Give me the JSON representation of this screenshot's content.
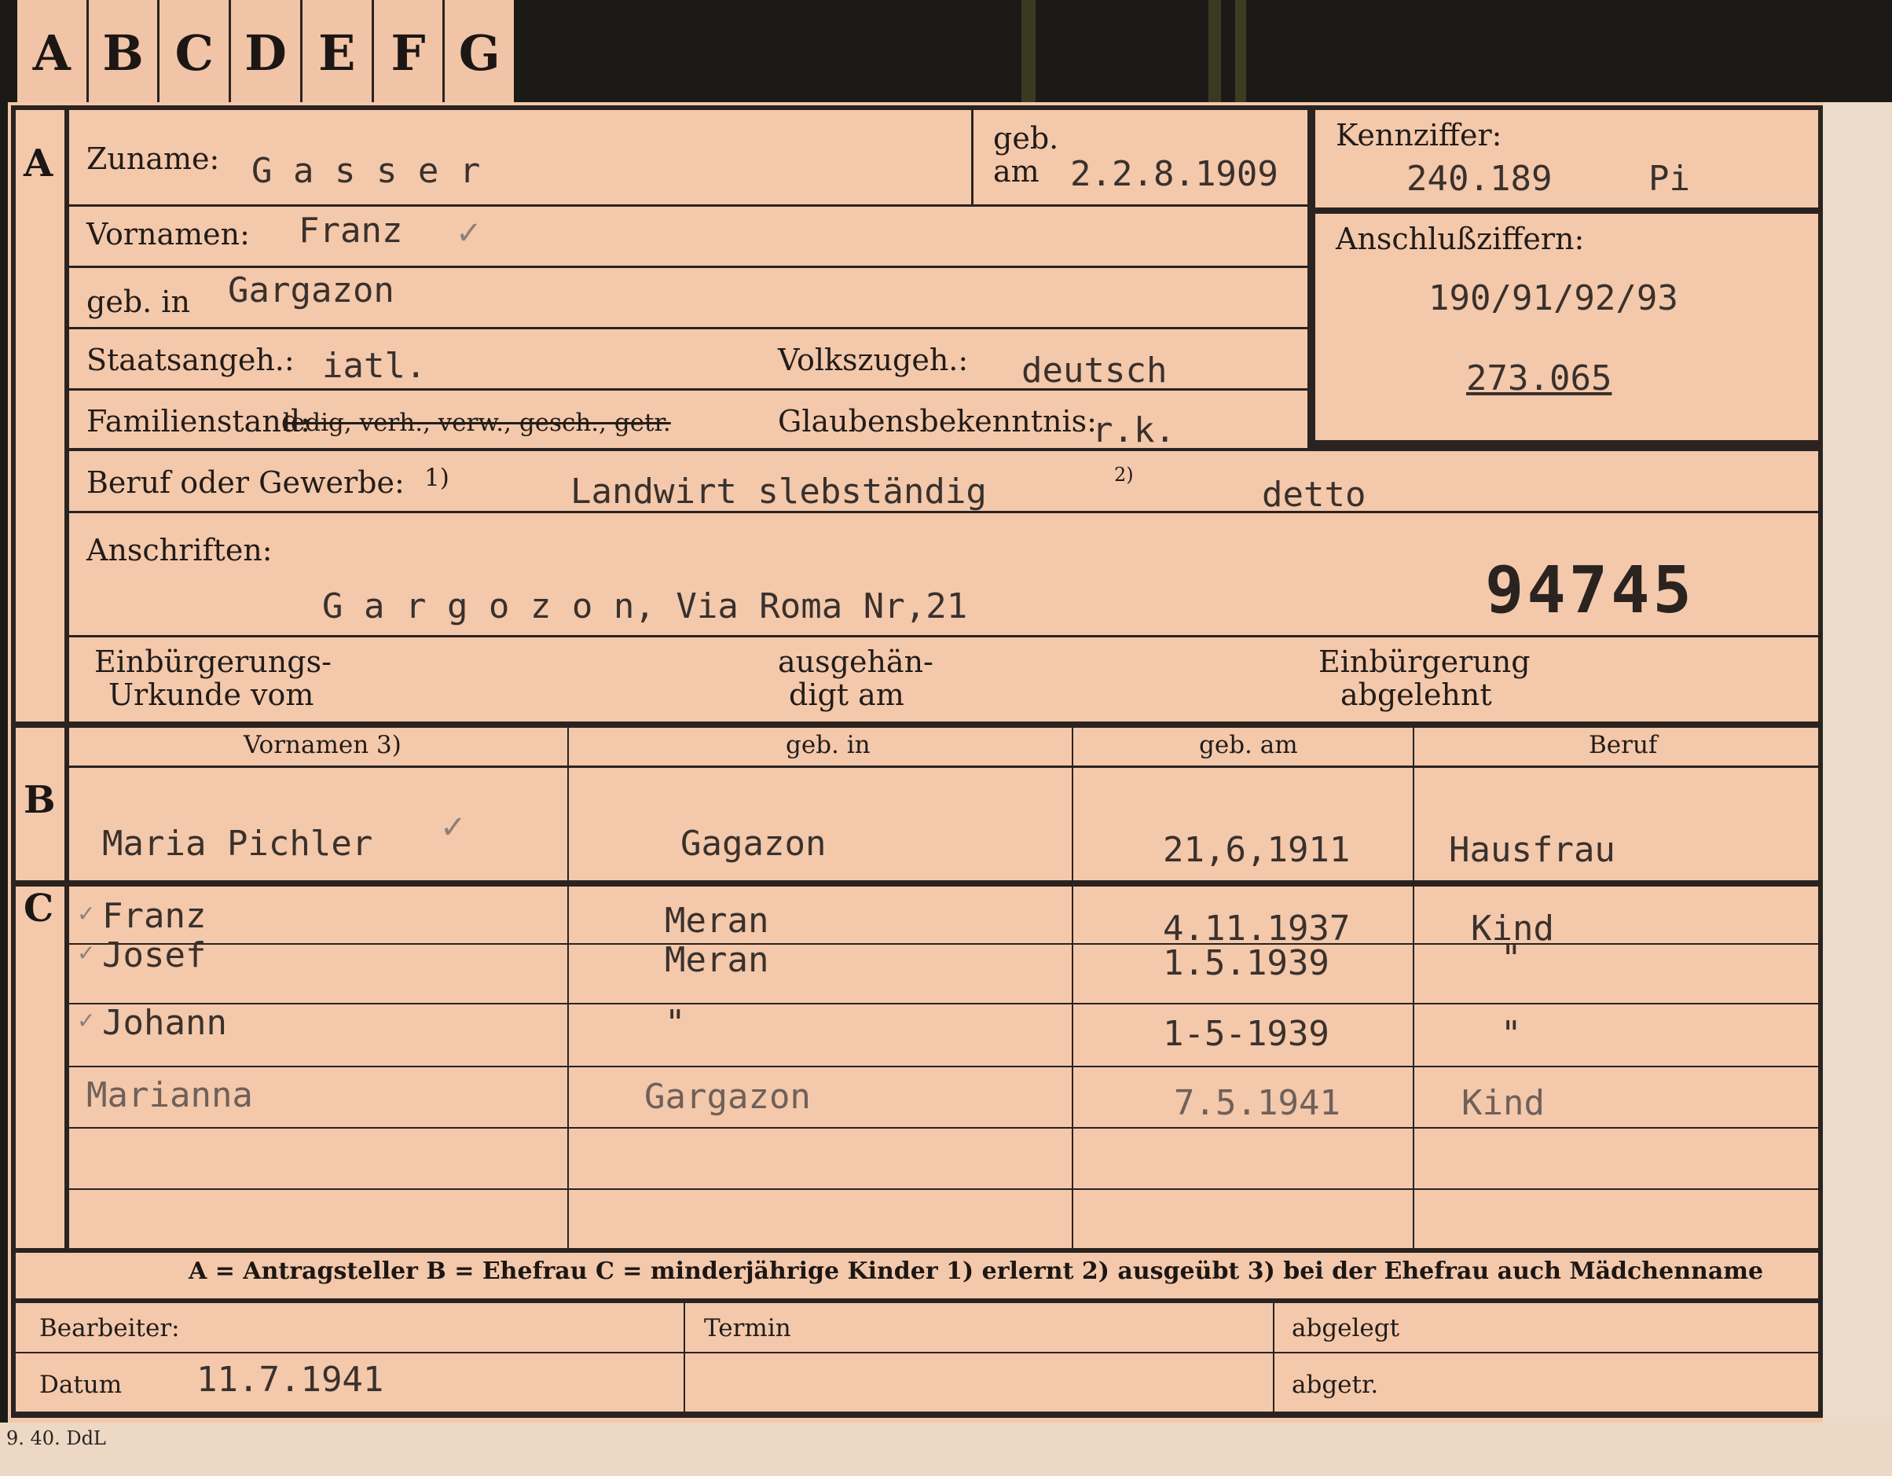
{
  "tabs": [
    "A",
    "B",
    "C",
    "D",
    "E",
    "F",
    "G"
  ],
  "section_a": {
    "marker": "A",
    "zuname_label": "Zuname:",
    "zuname_value": "G a s s e r",
    "geb_label": "geb.",
    "geb_am_label": "am",
    "geb_am_value": "2.2.8.1909",
    "kennziffer_label": "Kennziffer:",
    "kennziffer_value": "240.189",
    "kennziffer_suffix": "Pi",
    "anschluss_label": "Anschlußziffern:",
    "anschluss_value": "190/91/92/93",
    "anschluss_value_2": "273.065",
    "vornamen_label": "Vornamen:",
    "vornamen_value": "Franz",
    "geb_in_label": "geb. in",
    "geb_in_value": "Gargazon",
    "staatsangeh_label": "Staatsangeh.:",
    "staatsangeh_value": "iatl.",
    "volkszugeh_label": "Volkszugeh.:",
    "volkszugeh_value": "deutsch",
    "familienstand_label": "Familienstand:",
    "familienstand_options": "ledig, verh., verw., gesch., getr.",
    "glaubens_label": "Glaubensbekenntnis:",
    "glaubens_value": "r.k.",
    "beruf_label": "Beruf oder Gewerbe:",
    "beruf_note1": "1)",
    "beruf_value": "Landwirt slebständig",
    "beruf_note2": "2)",
    "beruf_value2": "detto",
    "anschriften_label": "Anschriften:",
    "anschriften_value": "G a r g o z o n, Via Roma Nr,21",
    "stamp_number": "94745",
    "einb_urkunde_label_1": "Einbürgerungs-",
    "einb_urkunde_label_2": "Urkunde vom",
    "ausgehaend_label_1": "ausgehän-",
    "ausgehaend_label_2": "digt am",
    "einb_abgelehnt_label_1": "Einbürgerung",
    "einb_abgelehnt_label_2": "abgelehnt"
  },
  "section_b": {
    "marker": "B",
    "headers": [
      "Vornamen 3)",
      "geb. in",
      "geb. am",
      "Beruf"
    ],
    "row": {
      "name": "Maria Pichler",
      "place": "Gagazon",
      "date": "21,6,1911",
      "job": "Hausfrau"
    }
  },
  "section_c": {
    "marker": "C",
    "rows": [
      {
        "name": "Franz",
        "place": "Meran",
        "date": "4.11.1937",
        "job": "Kind"
      },
      {
        "name": "Josef",
        "place": "Meran",
        "date": "1.5.1939",
        "job": "\""
      },
      {
        "name": "Johann",
        "place": "\"",
        "date": "1-5-1939",
        "job": "\""
      },
      {
        "name": "Marianna",
        "place": "Gargazon",
        "date": "7.5.1941",
        "job": "Kind"
      }
    ]
  },
  "legend": "A = Antragsteller   B = Ehefrau   C = minderjährige Kinder   1) erlernt   2) ausgeübt   3) bei der Ehefrau auch Mädchenname",
  "bottom": {
    "bearbeiter_label": "Bearbeiter:",
    "datum_label": "Datum",
    "datum_value": "11.7.1941",
    "termin_label": "Termin",
    "abgelegt_label": "abgelegt",
    "abgetr_label": "abgetr."
  },
  "footer": "9. 40. DdL",
  "colors": {
    "card": "#f3c8ab",
    "ink": "#2a2320",
    "background": "#1b1a16"
  }
}
